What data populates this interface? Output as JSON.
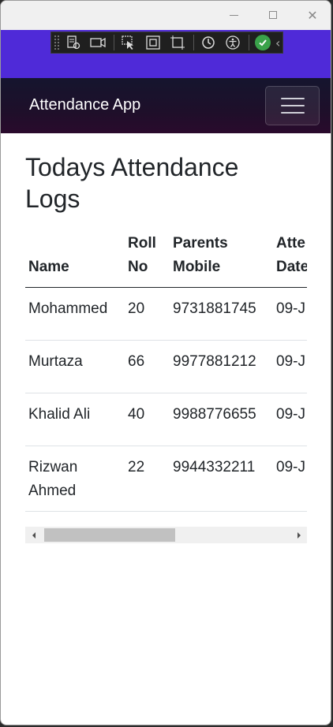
{
  "navbar": {
    "brand": "Attendance App"
  },
  "page": {
    "title": "Todays Attendance Logs"
  },
  "table": {
    "headers": [
      [
        "Name"
      ],
      [
        "Roll",
        "No"
      ],
      [
        "Parents",
        "Mobile"
      ],
      [
        "Atte",
        "Date"
      ]
    ],
    "rows": [
      {
        "name": [
          "Mohammed"
        ],
        "roll": "20",
        "mobile": "9731881745",
        "date": "09-J"
      },
      {
        "name": [
          "Murtaza"
        ],
        "roll": "66",
        "mobile": "9977881212",
        "date": "09-J"
      },
      {
        "name": [
          "Khalid Ali"
        ],
        "roll": "40",
        "mobile": "9988776655",
        "date": "09-J"
      },
      {
        "name": [
          "Rizwan",
          "Ahmed"
        ],
        "roll": "22",
        "mobile": "9944332211",
        "date": "09-J"
      }
    ]
  },
  "scroll": {
    "position": 0
  },
  "icons": {
    "devtools": [
      "inspect-tree-icon",
      "camera-icon",
      "select-element-icon",
      "frame-icon",
      "display-layout-icon",
      "hot-reload-icon",
      "accessibility-icon",
      "check-icon",
      "chevron-left-icon"
    ]
  },
  "colors": {
    "accent_bar": "#4f2ad8",
    "navbar": "#1e0f2a",
    "check": "#3aa24a"
  }
}
